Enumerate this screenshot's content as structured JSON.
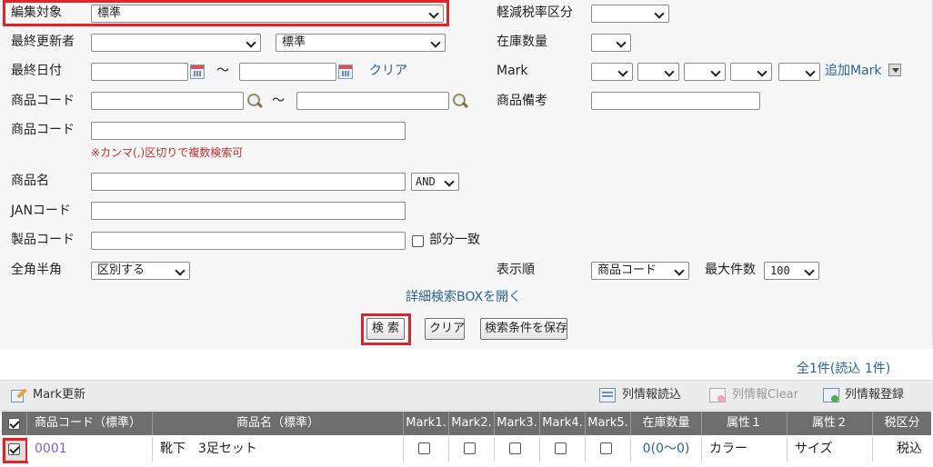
{
  "form": {
    "edit_target": {
      "label": "編集対象",
      "value": "標準"
    },
    "last_updater": {
      "label": "最終更新者",
      "value": "",
      "value2": "標準"
    },
    "last_date": {
      "label": "最終日付",
      "tilde": "～",
      "clear": "クリア"
    },
    "product_code_range": {
      "label": "商品コード",
      "tilde": "～"
    },
    "product_code_multi": {
      "label": "商品コード",
      "note": "※カンマ(,)区切りで複数検索可"
    },
    "product_name": {
      "label": "商品名",
      "op": "AND"
    },
    "jan_code": {
      "label": "JANコード"
    },
    "manufacturer_code": {
      "label": "製品コード",
      "partial_match": "部分一致"
    },
    "width_mode": {
      "label": "全角半角",
      "value": "区別する"
    },
    "tax_class": {
      "label": "軽減税率区分"
    },
    "stock_qty": {
      "label": "在庫数量"
    },
    "mark": {
      "label": "Mark",
      "add": "追加Mark"
    },
    "product_remarks": {
      "label": "商品備考"
    },
    "sort": {
      "label": "表示順",
      "value": "商品コード"
    },
    "max_count": {
      "label": "最大件数",
      "value": "100"
    },
    "detail_link": "詳細検索BOXを開く",
    "search_button": "検 索",
    "clear_button": "クリア",
    "save_button": "検索条件を保存"
  },
  "result": {
    "count_text": "全1件(読込 1件)",
    "toolbar": {
      "mark_update": "Mark更新",
      "col_read": "列情報読込",
      "col_clear": "列情報Clear",
      "col_register": "列情報登録"
    },
    "columns": [
      "商品コード（標準）",
      "商品名（標準）",
      "Mark1.",
      "Mark2.",
      "Mark3.",
      "Mark4.",
      "Mark5.",
      "在庫数量",
      "属性１",
      "属性２",
      "税区分"
    ],
    "rows": [
      {
        "checked": true,
        "code": "0001",
        "name": "靴下　3足セット",
        "stock": "0(0～0)",
        "attr1": "カラー",
        "attr2": "サイズ",
        "tax": "税込"
      }
    ]
  },
  "colors": {
    "accent_red": "#e0242c",
    "link_blue": "#2a6496",
    "header_gray": "#6e6e6e"
  }
}
